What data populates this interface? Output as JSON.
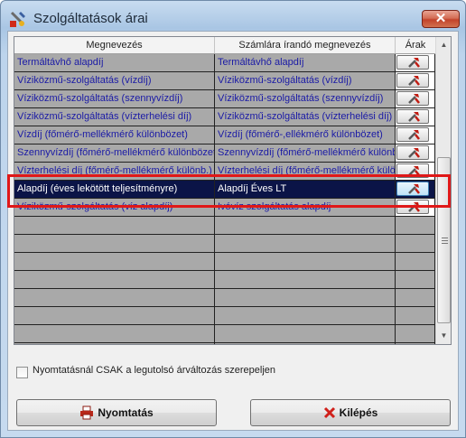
{
  "window": {
    "title": "Szolgáltatások árai",
    "close_glyph": "✕"
  },
  "grid": {
    "columns": [
      "Megnevezés",
      "Számlára írandó megnevezés",
      "Árak"
    ],
    "rows": [
      {
        "name": "Termáltávhő alapdíj",
        "invoice_name": "Termáltávhő alapdíj",
        "selected": false
      },
      {
        "name": "Víziközmű-szolgáltatás (vízdíj)",
        "invoice_name": "Víziközmű-szolgáltatás (vízdíj)",
        "selected": false
      },
      {
        "name": "Víziközmű-szolgáltatás (szennyvízdíj)",
        "invoice_name": "Víziközmű-szolgáltatás (szennyvízdíj)",
        "selected": false
      },
      {
        "name": "Víziközmű-szolgáltatás (vízterhelési díj)",
        "invoice_name": "Víziközmű-szolgáltatás (vízterhelési díj)",
        "selected": false
      },
      {
        "name": "Vízdíj (főmérő-mellékmérő különbözet)",
        "invoice_name": "Vízdíj (főmérő-,ellékmérő különbözet)",
        "selected": false
      },
      {
        "name": "Szennyvízdíj (főmérő-mellékmérő különbözet)",
        "invoice_name": "Szennyvízdíj (főmérő-mellékmérő különbözet)",
        "selected": false
      },
      {
        "name": "Vízterhelési díj (főmérő-mellékmérő különb.)",
        "invoice_name": "Vízterhelési díj (főmérő-mellékmérő különbözet)",
        "selected": false
      },
      {
        "name": "Alapdíj (éves lekötött teljesítményre)",
        "invoice_name": "Alapdíj Éves LT",
        "selected": true
      },
      {
        "name": "Víziközmű-szolgáltatás (víz alapdíj)",
        "invoice_name": "Ivóvíz szolgáltatás alapdíj",
        "selected": false
      }
    ],
    "edit_icon": "wrench-hammer-icon",
    "empty_rows": 8
  },
  "options": {
    "print_only_last_change_label": "Nyomtatásnál CSAK a legutolsó árváltozás szerepeljen",
    "print_only_last_change_checked": false
  },
  "buttons": {
    "print_label": "Nyomtatás",
    "print_icon": "printer-icon",
    "exit_label": "Kilépés",
    "exit_icon": "red-x-icon"
  },
  "colors": {
    "selected_row": "#0b1447",
    "row_text": "#1a1aa6",
    "highlight_box": "#e01818"
  }
}
